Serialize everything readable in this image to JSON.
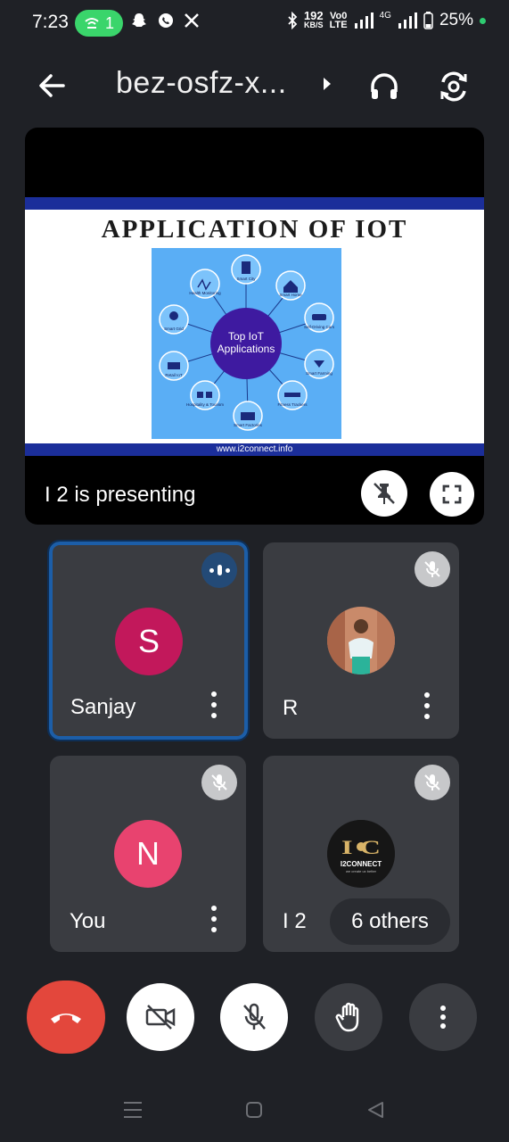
{
  "status_bar": {
    "time": "7:23",
    "hotspot_count": "1",
    "net_speed_value": "192",
    "net_speed_unit": "KB/S",
    "volte_top": "Vo0",
    "volte_bottom": "LTE",
    "network_type": "4G",
    "battery": "25%"
  },
  "header": {
    "meeting_title": "bez-osfz-x..."
  },
  "presentation": {
    "slide_title": "APPLICATION OF IOT",
    "diagram_center": [
      "Top IoT",
      "Applications"
    ],
    "diagram_items": [
      "Smart City",
      "Smart Home",
      "Self-Driving Cars",
      "Smart Farming",
      "Fitness Trackers",
      "Smart Factories",
      "Hospitality & Tourism",
      "Retail IoT",
      "Smart Grid",
      "Health Monitoring"
    ],
    "slide_footer": "www.i2connect.info",
    "presenting_label": "I 2 is presenting"
  },
  "participants": [
    {
      "name": "Sanjay",
      "initial": "S",
      "avatar_color": "#c2185b",
      "speaking": true
    },
    {
      "name": "R",
      "initial": "",
      "avatar_color": "#8a5a3c",
      "speaking": false
    },
    {
      "name": "You",
      "initial": "N",
      "avatar_color": "#e8436f",
      "speaking": false
    },
    {
      "name": "I 2",
      "initial": "",
      "avatar_color": "#1a1a1a",
      "speaking": false
    }
  ],
  "logo": {
    "mark": "I C",
    "name": "I2CONNECT",
    "tagline": "we create ux better"
  },
  "others_label": "6 others",
  "colors": {
    "background": "#1f2126",
    "tile": "#3a3c41",
    "end_call": "#e3473c",
    "active_border": "#1c5ea8"
  }
}
